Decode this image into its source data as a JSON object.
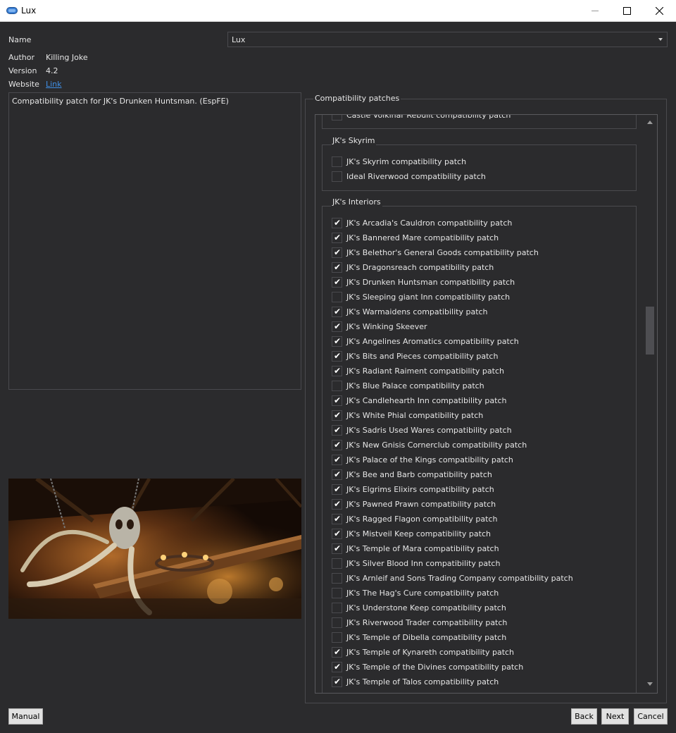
{
  "window": {
    "title": "Lux",
    "minimize_icon": "minimize-icon",
    "maximize_icon": "maximize-icon",
    "close_icon": "close-icon"
  },
  "info": {
    "name_label": "Name",
    "name_value": "Lux",
    "author_label": "Author",
    "author_value": "Killing Joke",
    "version_label": "Version",
    "version_value": "4.2",
    "website_label": "Website",
    "website_link": "Link"
  },
  "description": "Compatibility patch for JK's Drunken Huntsman. (EspFE)",
  "patches": {
    "title": "Compatibility patches",
    "partial_item": {
      "label": "Castle Volkihar Rebuilt compatibility patch",
      "checked": false
    },
    "groups": [
      {
        "title": "JK's Skyrim",
        "items": [
          {
            "label": "JK's Skyrim compatibility patch",
            "checked": false
          },
          {
            "label": "Ideal Riverwood compatibility patch",
            "checked": false
          }
        ]
      },
      {
        "title": "JK's Interiors",
        "items": [
          {
            "label": "JK's Arcadia's Cauldron compatibility patch",
            "checked": true
          },
          {
            "label": "JK's Bannered Mare compatibility patch",
            "checked": true
          },
          {
            "label": "JK's Belethor's General Goods compatibility patch",
            "checked": true
          },
          {
            "label": "JK's Dragonsreach compatibility patch",
            "checked": true
          },
          {
            "label": "JK's Drunken Huntsman compatibility patch",
            "checked": true
          },
          {
            "label": "JK's Sleeping giant Inn compatibility patch",
            "checked": false
          },
          {
            "label": "JK's Warmaidens compatibility patch",
            "checked": true
          },
          {
            "label": "JK's Winking Skeever",
            "checked": true
          },
          {
            "label": "JK's Angelines Aromatics compatibility patch",
            "checked": true
          },
          {
            "label": "JK's Bits and Pieces compatibility patch",
            "checked": true
          },
          {
            "label": "JK's Radiant Raiment compatibility patch",
            "checked": true
          },
          {
            "label": "JK's Blue Palace compatibility patch",
            "checked": false
          },
          {
            "label": "JK's Candlehearth Inn compatibility patch",
            "checked": true
          },
          {
            "label": "JK's White Phial compatibility patch",
            "checked": true
          },
          {
            "label": "JK's Sadris Used Wares compatibility patch",
            "checked": true
          },
          {
            "label": "JK's New Gnisis Cornerclub compatibility patch",
            "checked": true
          },
          {
            "label": "JK's Palace of the Kings compatibility patch",
            "checked": true
          },
          {
            "label": "JK's Bee and Barb compatibility patch",
            "checked": true
          },
          {
            "label": "JK's Elgrims Elixirs compatibility patch",
            "checked": true
          },
          {
            "label": "JK's Pawned Prawn compatibility patch",
            "checked": true
          },
          {
            "label": "JK's Ragged Flagon compatibility patch",
            "checked": true
          },
          {
            "label": "JK's Mistveil Keep compatibility patch",
            "checked": true
          },
          {
            "label": "JK's Temple of Mara compatibility patch",
            "checked": true
          },
          {
            "label": "JK's Silver Blood Inn compatibility patch",
            "checked": false
          },
          {
            "label": "JK's Arnleif and Sons Trading Company compatibility patch",
            "checked": false
          },
          {
            "label": "JK's The Hag's Cure compatibility patch",
            "checked": false
          },
          {
            "label": "JK's Understone Keep compatibility patch",
            "checked": false
          },
          {
            "label": "JK's Riverwood Trader compatibility patch",
            "checked": false
          },
          {
            "label": "JK's Temple of Dibella compatibility patch",
            "checked": false
          },
          {
            "label": "JK's Temple of Kynareth compatibility patch",
            "checked": true
          },
          {
            "label": "JK's Temple of the Divines compatibility patch",
            "checked": true
          },
          {
            "label": "JK's Temple of Talos compatibility patch",
            "checked": true
          }
        ]
      }
    ]
  },
  "buttons": {
    "manual": "Manual",
    "back": "Back",
    "next": "Next",
    "cancel": "Cancel"
  },
  "colors": {
    "background": "#2b2b2d",
    "border": "#4a4a4e",
    "link": "#3f8fe6",
    "app_icon": "#3a7fd5"
  }
}
